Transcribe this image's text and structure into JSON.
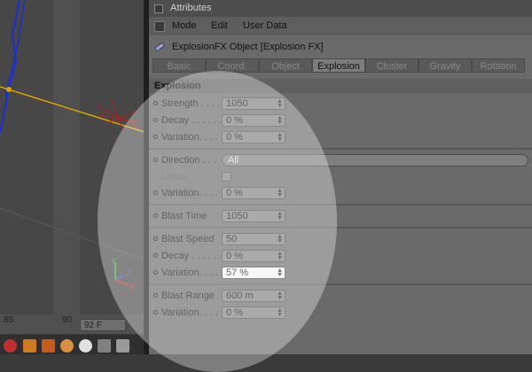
{
  "viewport": {
    "timeline_ticks": [
      "85",
      "90"
    ],
    "frame_value": "92 F",
    "axis_labels": {
      "y": "Y",
      "z": "Z",
      "x": "X"
    }
  },
  "panel": {
    "window_title": "Attributes",
    "menu": [
      "Mode",
      "Edit",
      "User Data"
    ],
    "object_name": "ExplosionFX Object [Explosion FX]",
    "tabs": [
      "Basic",
      "Coord.",
      "Object",
      "Explosion",
      "Cluster",
      "Gravity",
      "Rotation"
    ],
    "active_tab": "Explosion",
    "section_title": "Explosion",
    "params": {
      "strength": {
        "label": "Strength . . . .",
        "value": "1050"
      },
      "decay1": {
        "label": "Decay . . . . . .",
        "value": "0 %"
      },
      "variation1": {
        "label": "Variation. . . .",
        "value": "0 %"
      },
      "direction": {
        "label": "Direction . . .",
        "value": "All"
      },
      "linear": {
        "label": "Linear . . . . . ."
      },
      "variation2": {
        "label": "Variation. . . .",
        "value": "0 %"
      },
      "blast_time": {
        "label": "Blast Time",
        "value": "1050"
      },
      "blast_speed": {
        "label": "Blast Speed",
        "value": "50"
      },
      "decay2": {
        "label": "Decay . . . . . .",
        "value": "0 %"
      },
      "variation3": {
        "label": "Variation. . . .",
        "value": "57 %"
      },
      "blast_range": {
        "label": "Blast Range",
        "value": "600 m"
      },
      "variation4": {
        "label": "Variation. . . .",
        "value": "0 %"
      }
    }
  },
  "colors": {
    "spline_blue": "#1a2fd0",
    "axis_yellow": "#d8a400",
    "emitter_red": "#b02020"
  },
  "icons": [
    "explosion-object-icon",
    "help-icon",
    "move-icon",
    "scale-icon",
    "rotate-icon",
    "points-icon",
    "doc-icon"
  ]
}
